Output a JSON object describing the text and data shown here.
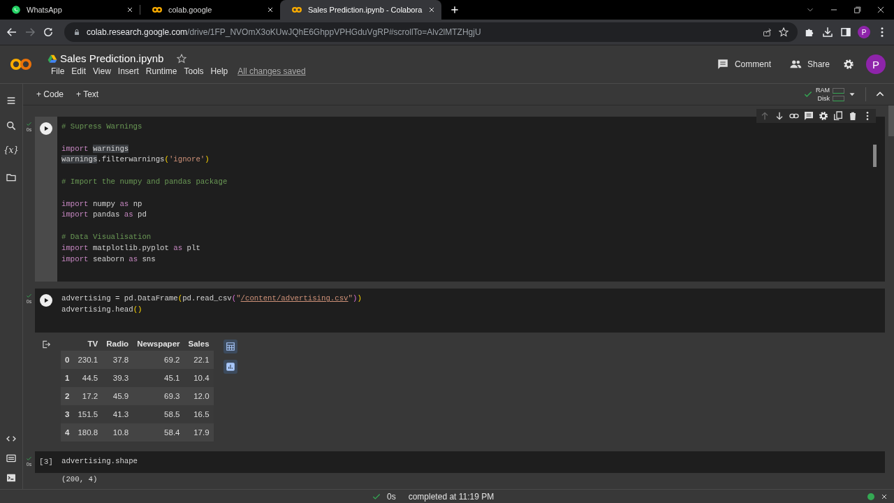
{
  "browser": {
    "tabs": [
      {
        "title": "WhatsApp",
        "kind": "whatsapp",
        "selected": false
      },
      {
        "title": "colab.google",
        "kind": "colab",
        "selected": false
      },
      {
        "title": "Sales Prediction.ipynb - Colabora",
        "kind": "colab",
        "selected": true
      }
    ],
    "nav": {
      "forward_disabled": true
    },
    "url": {
      "host": "colab.research.google.com",
      "path": "/drive/1FP_NVOmX3oKUwJQhE6GhppVPHGduVgRP#scrollTo=Alv2lMTZHgjU"
    },
    "avatar": "P"
  },
  "header": {
    "title": "Sales Prediction.ipynb",
    "menu": [
      "File",
      "Edit",
      "View",
      "Insert",
      "Runtime",
      "Tools",
      "Help"
    ],
    "save_status": "All changes saved",
    "comment": "Comment",
    "share": "Share",
    "avatar": "P"
  },
  "toolbar": {
    "add": [
      "+ Code",
      "+ Text"
    ],
    "resources": [
      "RAM",
      "Disk"
    ]
  },
  "sidebar": {
    "variables": "{x}"
  },
  "cells": [
    {
      "focused": true,
      "exec_time": "0s",
      "blocks": [
        [
          [
            {
              "text": "# Supress Warnings",
              "kind": "comment"
            }
          ]
        ],
        [
          [
            {
              "text": "import ",
              "kind": "keyword"
            },
            {
              "text": "warnings",
              "kind": "match"
            }
          ],
          [
            {
              "text": "warnings",
              "kind": "match"
            },
            {
              "text": ".filterwarnings",
              "kind": "plain"
            },
            {
              "text": "(",
              "kind": "bracket1"
            },
            {
              "text": "'ignore'",
              "kind": "string"
            },
            {
              "text": ")",
              "kind": "bracket1"
            }
          ]
        ],
        [
          [
            {
              "text": "# Import the numpy and pandas package",
              "kind": "comment"
            }
          ]
        ],
        [
          [
            {
              "text": "import",
              "kind": "keyword"
            },
            {
              "text": " numpy ",
              "kind": "plain"
            },
            {
              "text": "as",
              "kind": "keyword"
            },
            {
              "text": " np",
              "kind": "plain"
            }
          ],
          [
            {
              "text": "import",
              "kind": "keyword"
            },
            {
              "text": " pandas ",
              "kind": "plain"
            },
            {
              "text": "as",
              "kind": "keyword"
            },
            {
              "text": " pd",
              "kind": "plain"
            }
          ]
        ],
        [
          [
            {
              "text": "# Data Visualisation",
              "kind": "comment"
            }
          ],
          [
            {
              "text": "import",
              "kind": "keyword"
            },
            {
              "text": " matplotlib.pyplot ",
              "kind": "plain"
            },
            {
              "text": "as",
              "kind": "keyword"
            },
            {
              "text": " plt",
              "kind": "plain"
            }
          ],
          [
            {
              "text": "import",
              "kind": "keyword"
            },
            {
              "text": " seaborn ",
              "kind": "plain"
            },
            {
              "text": "as",
              "kind": "keyword"
            },
            {
              "text": " sns",
              "kind": "plain"
            }
          ]
        ]
      ]
    },
    {
      "focused": false,
      "exec_time": "0s",
      "blocks": [
        [
          [
            {
              "text": "advertising = pd.DataFrame",
              "kind": "plain"
            },
            {
              "text": "(",
              "kind": "bracket1"
            },
            {
              "text": "pd.read_csv",
              "kind": "plain"
            },
            {
              "text": "(",
              "kind": "bracket2"
            },
            {
              "text": "\"",
              "kind": "string"
            },
            {
              "text": "/content/advertising.csv",
              "kind": "link"
            },
            {
              "text": "\"",
              "kind": "string"
            },
            {
              "text": ")",
              "kind": "bracket2"
            },
            {
              "text": ")",
              "kind": "bracket1"
            }
          ],
          [
            {
              "text": "advertising.head",
              "kind": "plain"
            },
            {
              "text": "()",
              "kind": "bracket1"
            }
          ]
        ]
      ],
      "output": {
        "kind": "table",
        "columns": [
          "TV",
          "Radio",
          "Newspaper",
          "Sales"
        ],
        "rows": [
          {
            "index": "0",
            "values": [
              "230.1",
              "37.8",
              "69.2",
              "22.1"
            ]
          },
          {
            "index": "1",
            "values": [
              "44.5",
              "39.3",
              "45.1",
              "10.4"
            ]
          },
          {
            "index": "2",
            "values": [
              "17.2",
              "45.9",
              "69.3",
              "12.0"
            ]
          },
          {
            "index": "3",
            "values": [
              "151.5",
              "41.3",
              "58.5",
              "16.5"
            ]
          },
          {
            "index": "4",
            "values": [
              "180.8",
              "10.8",
              "58.4",
              "17.9"
            ]
          }
        ]
      }
    },
    {
      "focused": false,
      "exec_time": "0s",
      "exec_count": "[3]",
      "blocks": [
        [
          [
            {
              "text": "advertising.shape",
              "kind": "plain"
            }
          ]
        ]
      ],
      "output": {
        "kind": "text",
        "text": "(200, 4)"
      }
    }
  ],
  "status_bar": {
    "time": "0s",
    "message": "completed at 11:19 PM"
  }
}
